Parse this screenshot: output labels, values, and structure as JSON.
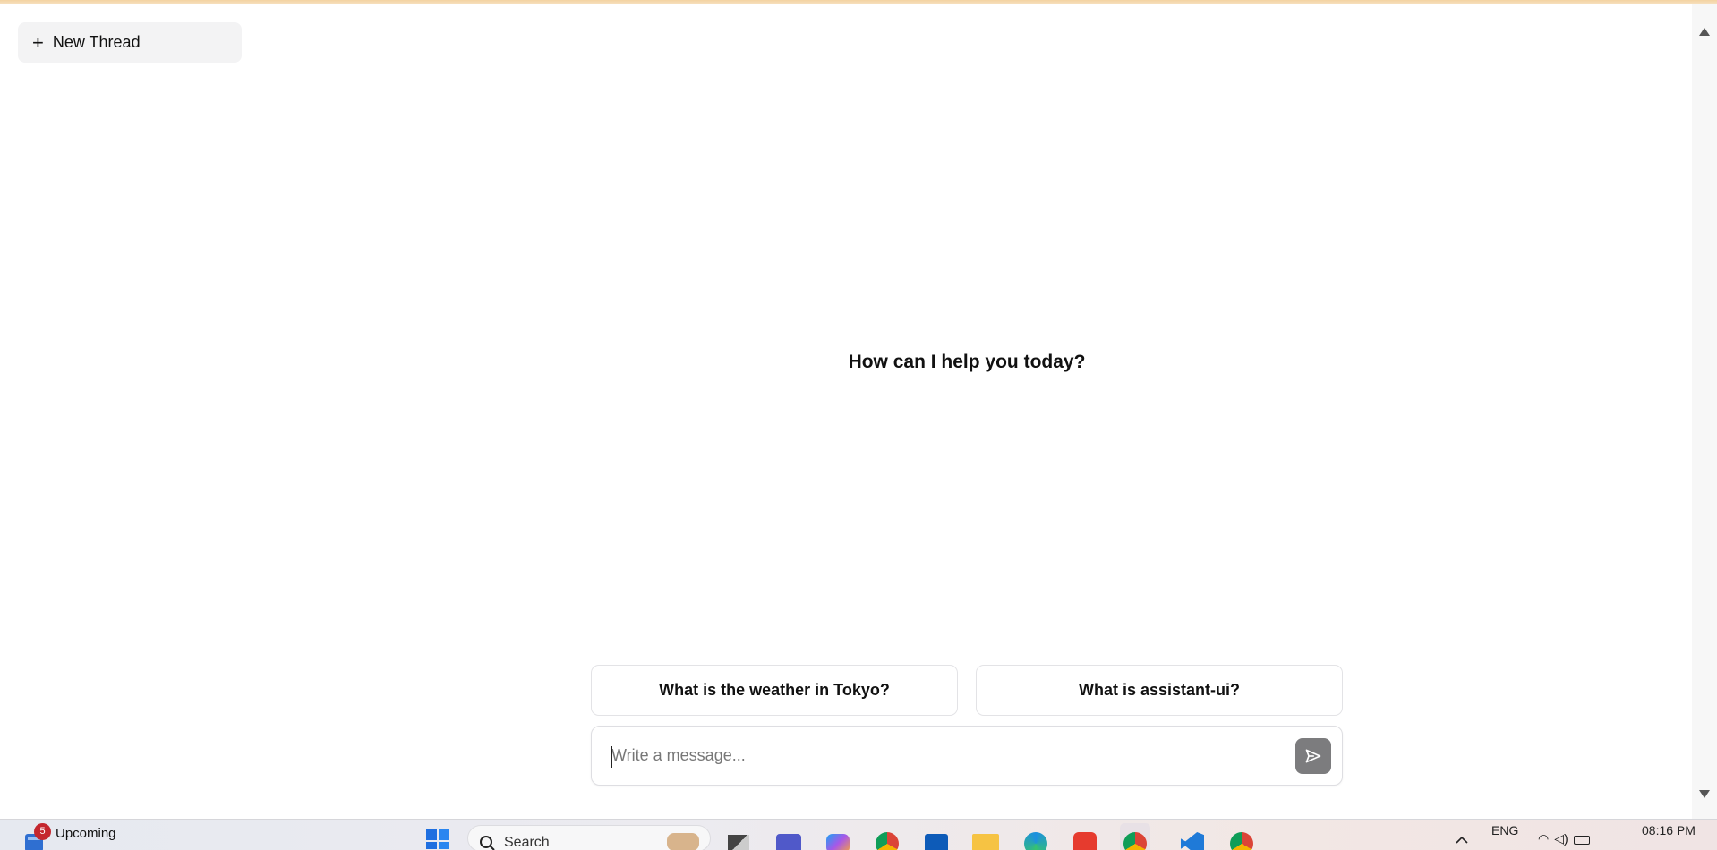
{
  "sidebar": {
    "new_thread_label": "New Thread"
  },
  "main": {
    "welcome_text": "How can I help you today?",
    "suggestions": [
      {
        "label": "What is the weather in Tokyo?"
      },
      {
        "label": "What is assistant-ui?"
      }
    ],
    "composer": {
      "placeholder": "Write a message...",
      "value": ""
    }
  },
  "taskbar": {
    "widget_badge": "5",
    "widget_label": "Upcoming",
    "search_placeholder": "Search",
    "language": "ENG",
    "time": "08:16 PM",
    "apps": [
      "task-view-icon",
      "teams-icon",
      "copilot-icon",
      "chrome-icon",
      "store-icon",
      "file-explorer-icon",
      "edge-icon",
      "wps-icon",
      "chrome-profile-icon",
      "vscode-icon",
      "chrome-icon"
    ]
  },
  "colors": {
    "accent_send": "#7c7c7e",
    "suggestion_border": "#e3e3e6",
    "top_strip": "#f3d2a0"
  }
}
